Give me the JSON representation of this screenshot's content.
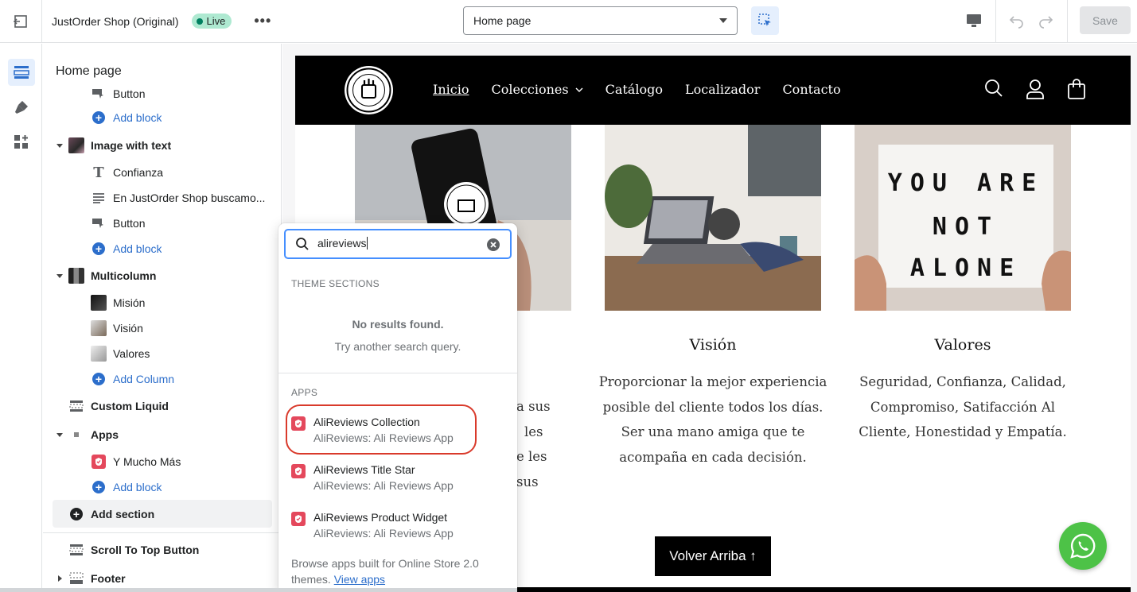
{
  "topbar": {
    "store_name": "JustOrder Shop (Original)",
    "status_badge": "Live",
    "more": "•••",
    "page_selector": "Home page",
    "save_label": "Save"
  },
  "sidebar": {
    "title": "Home page",
    "rows": [
      {
        "label": "Button",
        "kind": "block"
      },
      {
        "label": "Add block",
        "kind": "add"
      },
      {
        "label": "Image with text",
        "kind": "section"
      },
      {
        "label": "Confianza",
        "kind": "block"
      },
      {
        "label": "En JustOrder Shop buscamo...",
        "kind": "block"
      },
      {
        "label": "Button",
        "kind": "block"
      },
      {
        "label": "Add block",
        "kind": "add"
      },
      {
        "label": "Multicolumn",
        "kind": "section"
      },
      {
        "label": "Misión",
        "kind": "block"
      },
      {
        "label": "Visión",
        "kind": "block"
      },
      {
        "label": "Valores",
        "kind": "block"
      },
      {
        "label": "Add Column",
        "kind": "add"
      },
      {
        "label": "Custom Liquid",
        "kind": "section"
      },
      {
        "label": "Apps",
        "kind": "section"
      },
      {
        "label": "Y Mucho Más",
        "kind": "block"
      },
      {
        "label": "Add block",
        "kind": "add"
      },
      {
        "label": "Add section",
        "kind": "add-section"
      },
      {
        "label": "Scroll To Top Button",
        "kind": "section"
      },
      {
        "label": "Footer",
        "kind": "section"
      }
    ]
  },
  "popover": {
    "search_value": "alireviews",
    "theme_heading": "THEME SECTIONS",
    "no_results": "No results found.",
    "no_results_sub": "Try another search query.",
    "apps_heading": "APPS",
    "apps": [
      {
        "title": "AliReviews Collection",
        "subtitle": "AliReviews: Ali Reviews App"
      },
      {
        "title": "AliReviews Title Star",
        "subtitle": "AliReviews: Ali Reviews App"
      },
      {
        "title": "AliReviews Product Widget",
        "subtitle": "AliReviews: Ali Reviews App"
      }
    ],
    "browse_text": "Browse apps built for Online Store 2.0 themes.",
    "browse_link": "View apps"
  },
  "preview": {
    "nav": [
      "Inicio",
      "Colecciones",
      "Catálogo",
      "Localizador",
      "Contacto"
    ],
    "image_text": {
      "row1": "YOU ARE",
      "row2": "NOT",
      "row3": "ALONE"
    },
    "columns": [
      {
        "title": "Visión",
        "text": "Proporcionar la mejor experiencia posible del cliente todos los días. Ser una mano amiga que te acompaña en cada decisión."
      },
      {
        "title": "Valores",
        "text": "Seguridad, Confianza, Calidad, Compromiso, Satifacción Al Cliente, Honestidad y Empatía."
      }
    ],
    "partial_text": [
      "a sus",
      "les",
      "e les",
      "sus"
    ],
    "back_to_top": "Volver Arriba ↑"
  },
  "colors": {
    "accent": "#2c6ecb",
    "live_badge": "#aee9d1",
    "highlight_ring": "#d93a2b",
    "app_icon": "#e4485c",
    "whatsapp": "#4dc247"
  }
}
